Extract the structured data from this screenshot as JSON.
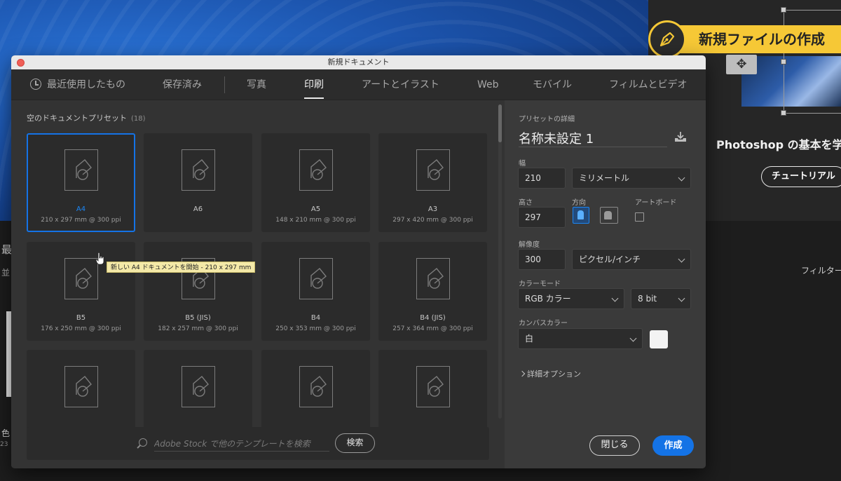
{
  "background": {
    "learn_title": "Photoshop の基本を学",
    "tutorial_button": "チュートリアル",
    "filter_label": "フィルター",
    "left_fragments": [
      "最",
      "並",
      "色",
      "23"
    ]
  },
  "banner": {
    "text": "新規ファイルの作成",
    "color": "#f6c836"
  },
  "dialog": {
    "title": "新規ドキュメント",
    "tabs": [
      {
        "label": "最近使用したもの"
      },
      {
        "label": "保存済み"
      },
      {
        "label": "写真"
      },
      {
        "label": "印刷"
      },
      {
        "label": "アートとイラスト"
      },
      {
        "label": "Web"
      },
      {
        "label": "モバイル"
      },
      {
        "label": "フィルムとビデオ"
      }
    ],
    "active_tab": "印刷",
    "presets": {
      "title": "空のドキュメントプリセット",
      "count": "(18)",
      "items": [
        {
          "name": "A4",
          "size": "210 x 297 mm @ 300 ppi"
        },
        {
          "name": "A6",
          "size": ""
        },
        {
          "name": "A5",
          "size": "148 x 210 mm @ 300 ppi"
        },
        {
          "name": "A3",
          "size": "297 x 420 mm @ 300 ppi"
        },
        {
          "name": "B5",
          "size": "176 x 250 mm @ 300 ppi"
        },
        {
          "name": "B5 (JIS)",
          "size": "182 x 257 mm @ 300 ppi"
        },
        {
          "name": "B4",
          "size": "250 x 353 mm @ 300 ppi"
        },
        {
          "name": "B4 (JIS)",
          "size": "257 x 364 mm @ 300 ppi"
        },
        {
          "name": "",
          "size": ""
        },
        {
          "name": "",
          "size": ""
        },
        {
          "name": "",
          "size": ""
        },
        {
          "name": "",
          "size": ""
        }
      ],
      "tooltip": "新しい A4 ドキュメントを開始 - 210 x 297 mm"
    },
    "search": {
      "placeholder": "Adobe Stock で他のテンプレートを検索",
      "button": "検索"
    },
    "details": {
      "heading": "プリセットの詳細",
      "doc_name": "名称未設定 1",
      "width_label": "幅",
      "width_value": "210",
      "unit": "ミリメートル",
      "height_label": "高さ",
      "height_value": "297",
      "orientation_label": "方向",
      "artboard_label": "アートボード",
      "resolution_label": "解像度",
      "resolution_value": "300",
      "resolution_unit": "ピクセル/インチ",
      "color_mode_label": "カラーモード",
      "color_mode": "RGB カラー",
      "bit_depth": "8 bit",
      "canvas_label": "カンバスカラー",
      "canvas_value": "白",
      "advanced": "詳細オプション",
      "close_button": "閉じる",
      "create_button": "作成"
    }
  }
}
